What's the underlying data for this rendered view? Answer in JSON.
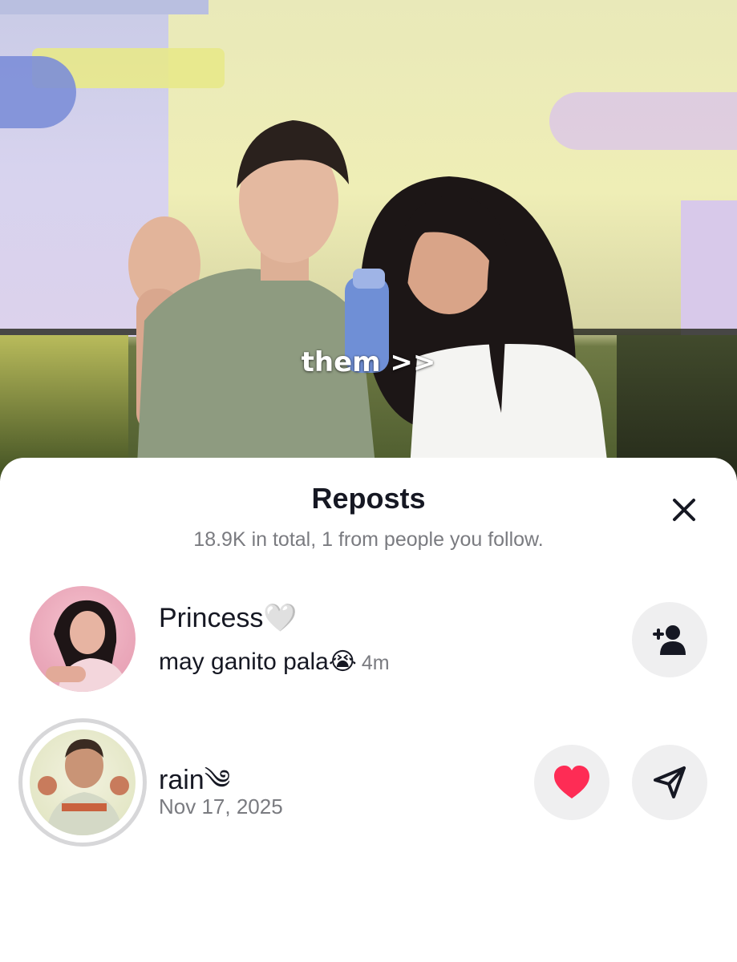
{
  "video": {
    "caption": "them >>"
  },
  "sheet": {
    "title": "Reposts",
    "subtitle": "18.9K in total, 1 from people you follow."
  },
  "reposts": [
    {
      "name": "Princess🤍",
      "comment": "may ganito pala😭",
      "time": "4m",
      "action_icon": "add-friend-icon"
    },
    {
      "name": "rain༄",
      "date": "Nov 17, 2025",
      "action_icons": [
        "heart-icon",
        "send-icon"
      ]
    }
  ],
  "colors": {
    "heart": "#fe2c55",
    "secondary_text": "#7a7b80",
    "button_bg": "#efeff0"
  }
}
